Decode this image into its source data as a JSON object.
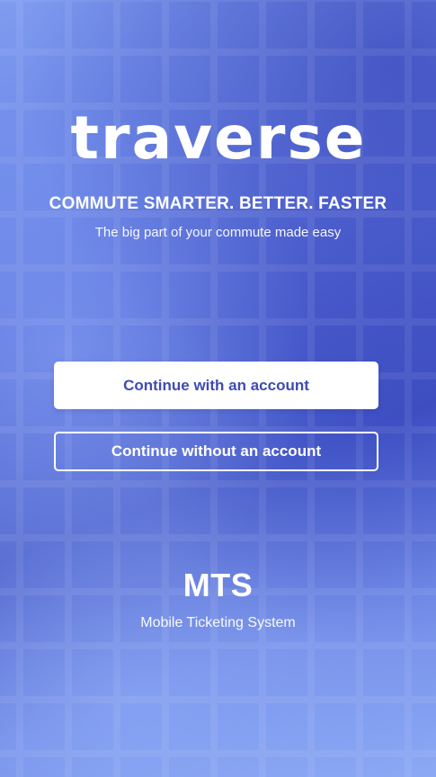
{
  "app": {
    "logo_text": "traverse",
    "tagline": "COMMUTE SMARTER. BETTER. FASTER",
    "subtitle": "The big part of your commute made easy"
  },
  "actions": {
    "primary_label": "Continue with an account",
    "secondary_label": "Continue without an account"
  },
  "footer": {
    "title": "MTS",
    "subtitle": "Mobile Ticketing System"
  },
  "colors": {
    "primary_text": "#3f4bb4",
    "background_top": "#3f4fc0",
    "background_light": "#8aa8f4"
  }
}
